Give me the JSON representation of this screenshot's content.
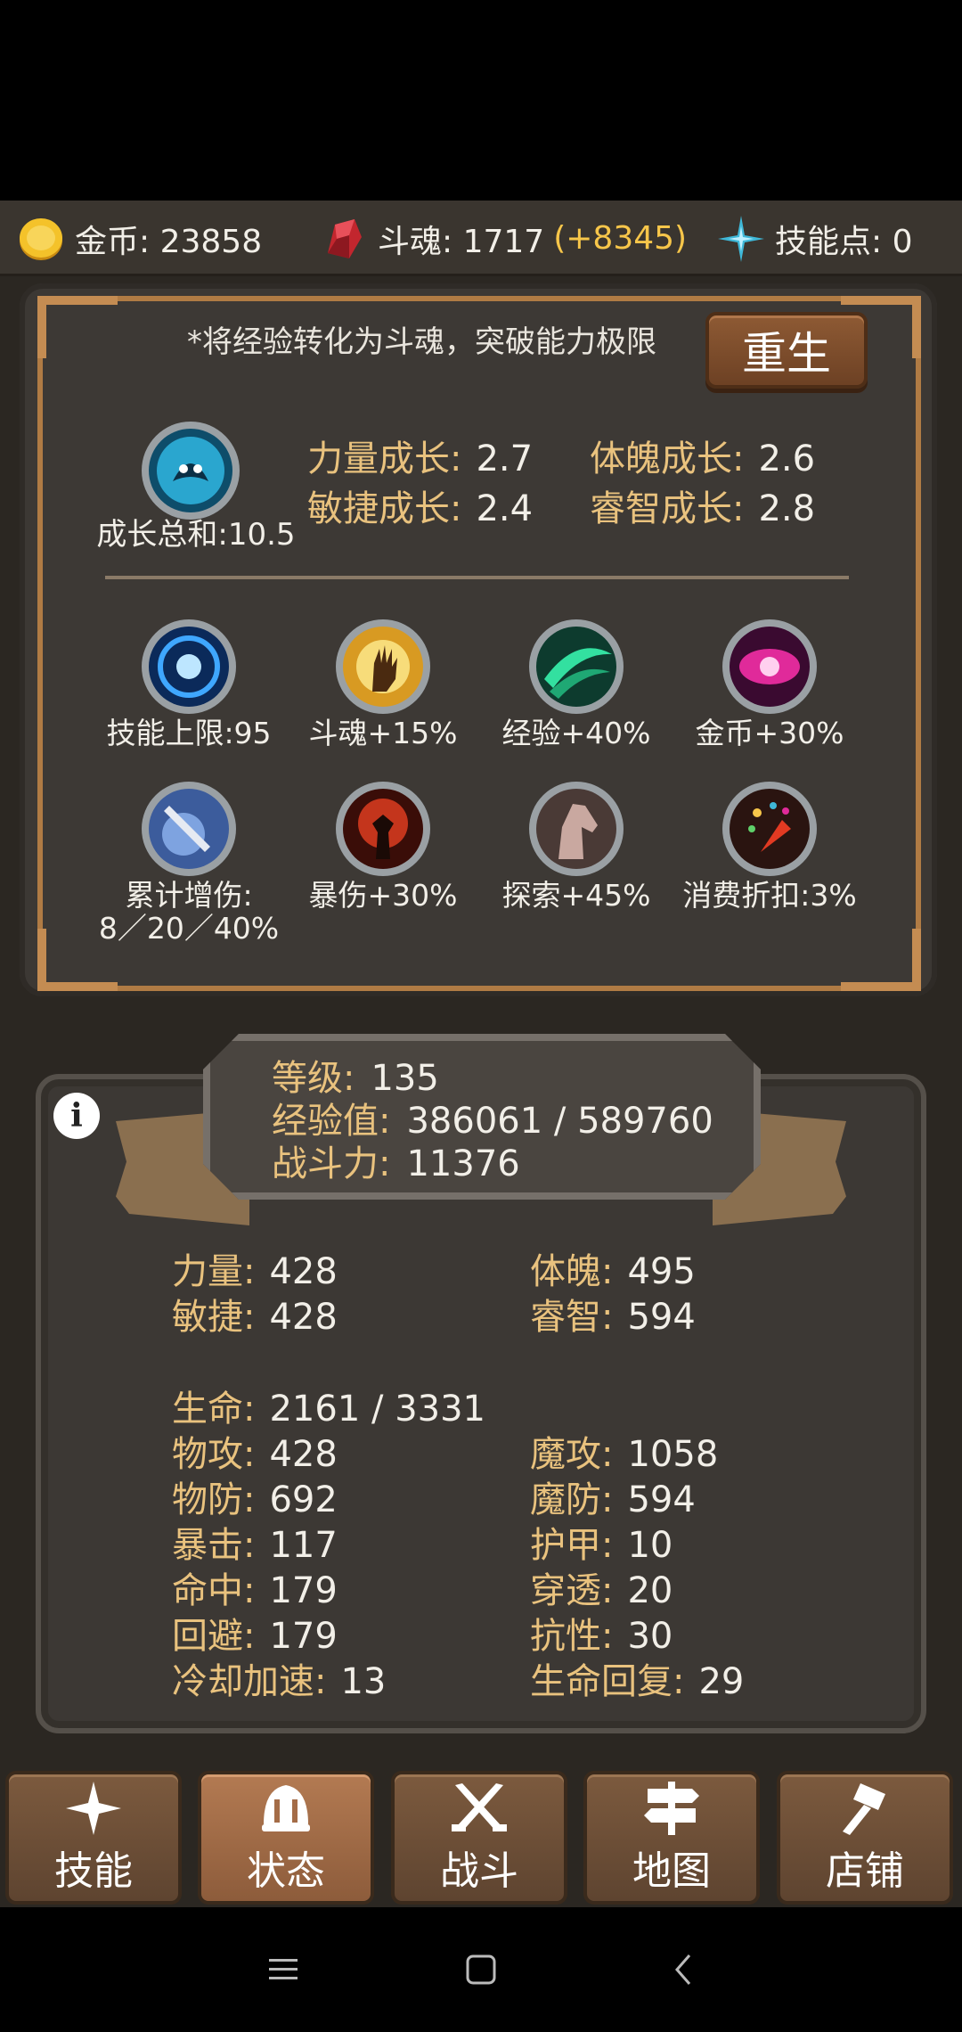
{
  "currency": {
    "gold_label": "金币: 23858",
    "soul_label": "斗魂: 1717",
    "soul_bonus": "(+8345)",
    "skill_points_label": "技能点: 0"
  },
  "rebirth": {
    "hint": "*将经验转化为斗魂，突破能力极限",
    "button": "重生",
    "growth_total": "成长总和:10.5",
    "growth_stats": [
      {
        "label": "力量成长:",
        "value": "2.7"
      },
      {
        "label": "体魄成长:",
        "value": "2.6"
      },
      {
        "label": "敏捷成长:",
        "value": "2.4"
      },
      {
        "label": "睿智成长:",
        "value": "2.8"
      }
    ],
    "perks": [
      {
        "label": "技能上限:95",
        "icon": "rune-circle-icon"
      },
      {
        "label": "斗魂+15%",
        "icon": "golden-hand-icon"
      },
      {
        "label": "经验+40%",
        "icon": "green-slash-icon"
      },
      {
        "label": "金币+30%",
        "icon": "magenta-eye-icon"
      },
      {
        "label": "累计增伤:\n8／20／40%",
        "icon": "sword-shield-icon"
      },
      {
        "label": "暴伤+30%",
        "icon": "fire-warrior-icon"
      },
      {
        "label": "探索+45%",
        "icon": "horse-head-icon"
      },
      {
        "label": "消费折扣:3%",
        "icon": "party-popper-icon"
      }
    ]
  },
  "level": {
    "level_label": "等级:",
    "level_value": "135",
    "exp_label": "经验值:",
    "exp_value": "386061 / 589760",
    "power_label": "战斗力:",
    "power_value": "11376"
  },
  "stats": {
    "str": {
      "label": "力量:",
      "value": "428"
    },
    "con": {
      "label": "体魄:",
      "value": "495"
    },
    "agi": {
      "label": "敏捷:",
      "value": "428"
    },
    "wis": {
      "label": "睿智:",
      "value": "594"
    },
    "hp": {
      "label": "生命:",
      "value": "2161 / 3331"
    },
    "patk": {
      "label": "物攻:",
      "value": "428"
    },
    "matk": {
      "label": "魔攻:",
      "value": "1058"
    },
    "pdef": {
      "label": "物防:",
      "value": "692"
    },
    "mdef": {
      "label": "魔防:",
      "value": "594"
    },
    "crit": {
      "label": "暴击:",
      "value": "117"
    },
    "armor": {
      "label": "护甲:",
      "value": "10"
    },
    "hit": {
      "label": "命中:",
      "value": "179"
    },
    "pen": {
      "label": "穿透:",
      "value": "20"
    },
    "dodge": {
      "label": "回避:",
      "value": "179"
    },
    "resist": {
      "label": "抗性:",
      "value": "30"
    },
    "cdr": {
      "label": "冷却加速:",
      "value": "13"
    },
    "regen": {
      "label": "生命回复:",
      "value": "29"
    }
  },
  "nav": [
    {
      "label": "技能",
      "icon": "sparkle-icon"
    },
    {
      "label": "状态",
      "icon": "helmet-icon",
      "active": true
    },
    {
      "label": "战斗",
      "icon": "crossed-swords-icon"
    },
    {
      "label": "地图",
      "icon": "signpost-icon"
    },
    {
      "label": "店铺",
      "icon": "hammer-icon"
    }
  ],
  "colors": {
    "label_gold": "#e9c27e",
    "bonus_yellow": "#f7c64a",
    "panel_bg": "#3c3834",
    "frame_brown": "#b07b44"
  }
}
